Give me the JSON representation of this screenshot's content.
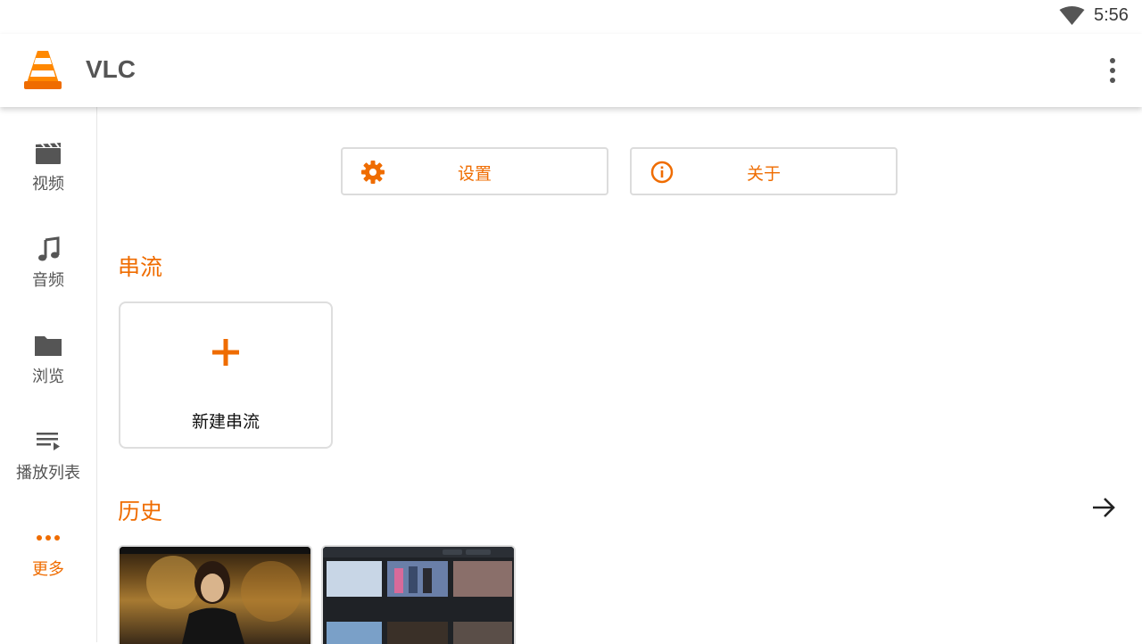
{
  "status_bar": {
    "time": "5:56",
    "wifi_icon": "wifi-icon"
  },
  "app_bar": {
    "title": "VLC",
    "logo_icon": "vlc-cone-logo",
    "menu_icon": "more-vert-icon"
  },
  "sidebar": {
    "items": [
      {
        "label": "视频",
        "icon": "movie-icon",
        "active": false
      },
      {
        "label": "音频",
        "icon": "music-note-icon",
        "active": false
      },
      {
        "label": "浏览",
        "icon": "folder-icon",
        "active": false
      },
      {
        "label": "播放列表",
        "icon": "playlist-icon",
        "active": false
      },
      {
        "label": "更多",
        "icon": "more-horiz-icon",
        "active": true
      }
    ]
  },
  "actions": {
    "settings_label": "设置",
    "settings_icon": "gear-icon",
    "about_label": "关于",
    "about_icon": "info-icon"
  },
  "streams": {
    "title": "串流",
    "new_stream_label": "新建串流",
    "new_stream_icon": "plus-icon"
  },
  "history": {
    "title": "历史",
    "arrow_icon": "arrow-right-icon",
    "items": [
      {
        "thumbnail": "video-thumbnail"
      },
      {
        "thumbnail": "video-thumbnail"
      }
    ]
  },
  "colors": {
    "accent": "#ef6c00",
    "text_secondary": "#555555",
    "border": "#dcdcdc"
  }
}
